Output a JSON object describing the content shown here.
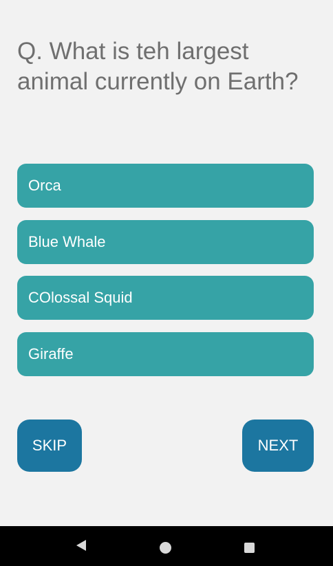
{
  "quiz": {
    "question": "Q. What is teh largest animal currently on Earth?",
    "options": [
      {
        "label": "Orca"
      },
      {
        "label": "Blue Whale"
      },
      {
        "label": "COlossal Squid"
      },
      {
        "label": "Giraffe"
      }
    ],
    "skip_label": "SKIP",
    "next_label": "NEXT"
  },
  "system_nav": {
    "back_icon": "triangle-back-icon",
    "home_icon": "circle-home-icon",
    "recents_icon": "square-recents-icon"
  },
  "colors": {
    "background": "#f2f2f2",
    "question_text": "#6f6f6f",
    "option_background": "#36a3a6",
    "nav_button_background": "#1c76a0",
    "system_bar": "#000000"
  }
}
